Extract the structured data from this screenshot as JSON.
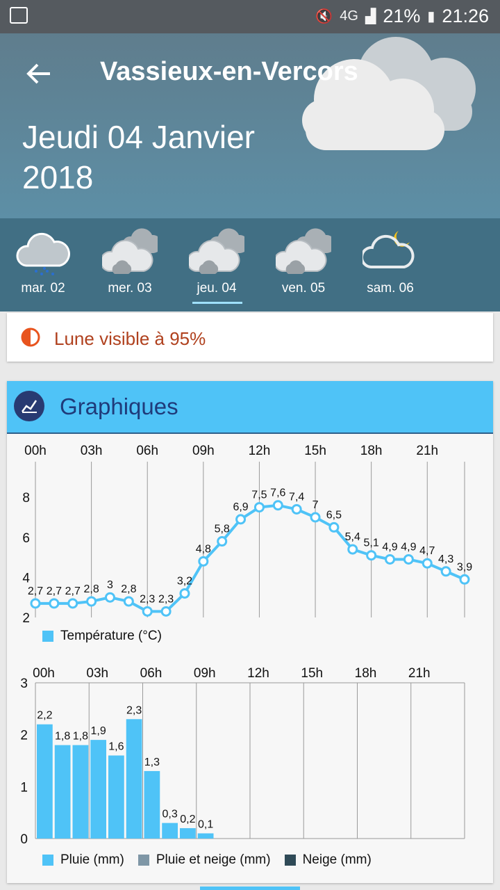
{
  "statusbar": {
    "battery": "21%",
    "time": "21:26",
    "network": "4G"
  },
  "header": {
    "back_icon": "arrow-back-icon",
    "city": "Vassieux-en-Vercors",
    "date_line1": "Jeudi 04 Janvier",
    "date_line2": "2018"
  },
  "days": [
    {
      "label": "mar. 02",
      "icon": "cloud-rain-icon"
    },
    {
      "label": "mer. 03",
      "icon": "clouds-icon"
    },
    {
      "label": "jeu. 04",
      "icon": "clouds-icon",
      "selected": true
    },
    {
      "label": "ven. 05",
      "icon": "clouds-icon"
    },
    {
      "label": "sam. 06",
      "icon": "cloud-moon-icon"
    }
  ],
  "moon": {
    "text": "Lune visible à 95%",
    "color": "#b0411e"
  },
  "graphs": {
    "title": "Graphiques",
    "header_color": "#4fc3f7"
  },
  "chart_data": [
    {
      "type": "line",
      "hours": [
        "00h",
        "03h",
        "06h",
        "09h",
        "12h",
        "15h",
        "18h",
        "21h"
      ],
      "x": [
        0,
        1,
        2,
        3,
        4,
        5,
        6,
        7,
        8,
        9,
        10,
        11,
        12,
        13,
        14,
        15,
        16,
        17,
        18,
        19,
        20,
        21,
        22,
        23
      ],
      "values": [
        2.7,
        2.7,
        2.7,
        2.8,
        3,
        2.8,
        2.3,
        2.3,
        3.2,
        4.8,
        5.8,
        6.9,
        7.5,
        7.6,
        7.4,
        7,
        6.5,
        5.4,
        5.1,
        4.9,
        4.9,
        4.7,
        4.3,
        3.9
      ],
      "labels": [
        "2,7",
        "2,7",
        "2,7",
        "2,8",
        "3",
        "2,8",
        "2,3",
        "2,3",
        "3,2",
        "4,8",
        "5,8",
        "6,9",
        "7,5",
        "7,6",
        "7,4",
        "7",
        "6,5",
        "5,4",
        "5,1",
        "4,9",
        "4,9",
        "4,7",
        "4,3",
        "3,9"
      ],
      "yticks": [
        "2",
        "4",
        "6",
        "8"
      ],
      "ylim": [
        2,
        9
      ],
      "legend": "Température (°C)",
      "color": "#4fc3f7"
    },
    {
      "type": "bar",
      "hours": [
        "00h",
        "03h",
        "06h",
        "09h",
        "12h",
        "15h",
        "18h",
        "21h"
      ],
      "x": [
        0,
        1,
        2,
        3,
        4,
        5,
        6,
        7,
        8,
        9
      ],
      "values": [
        2.2,
        1.8,
        1.8,
        1.9,
        1.6,
        2.3,
        1.3,
        0.3,
        0.2,
        0.1
      ],
      "labels": [
        "2,2",
        "1,8",
        "1,8",
        "1,9",
        "1,6",
        "2,3",
        "1,3",
        "0,3",
        "0,2",
        "0,1"
      ],
      "yticks": [
        "0",
        "1",
        "2",
        "3"
      ],
      "ylim": [
        0,
        3
      ],
      "legend": [
        {
          "name": "Pluie (mm)",
          "color": "#4fc3f7"
        },
        {
          "name": "Pluie et neige (mm)",
          "color": "#7f97a6"
        },
        {
          "name": "Neige (mm)",
          "color": "#2f4a57"
        }
      ]
    }
  ]
}
